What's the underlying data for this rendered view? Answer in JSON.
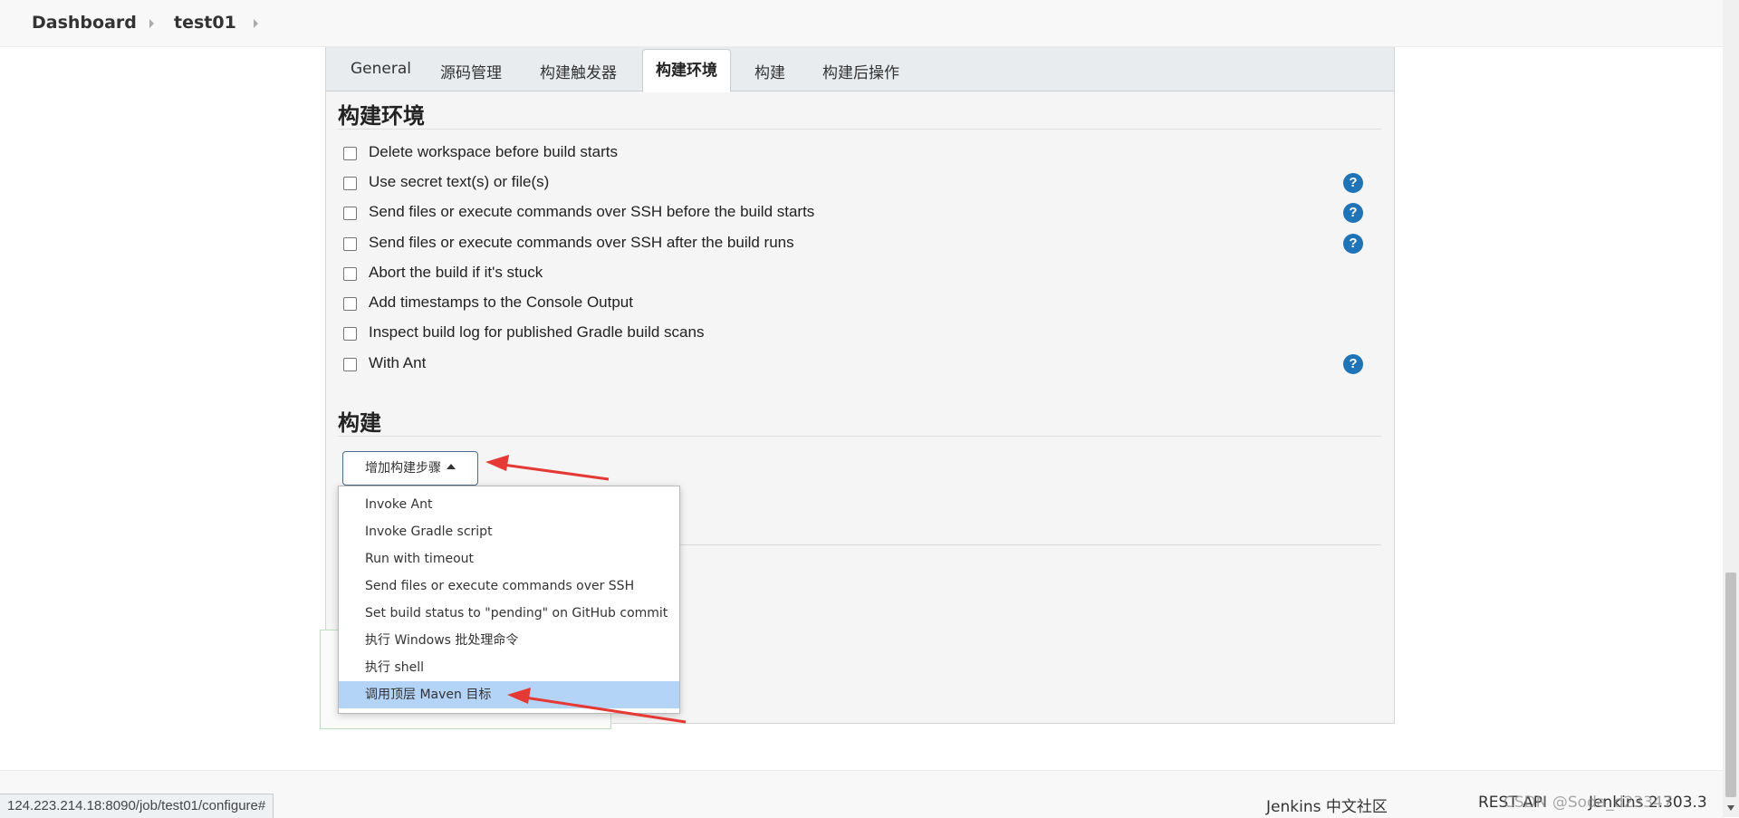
{
  "breadcrumb": {
    "items": [
      "Dashboard",
      "test01"
    ]
  },
  "tabs": [
    "General",
    "源码管理",
    "构建触发器",
    "构建环境",
    "构建",
    "构建后操作"
  ],
  "active_tab": "构建环境",
  "build_env": {
    "title": "构建环境",
    "options": [
      {
        "label": "Delete workspace before build starts",
        "checked": false,
        "help": false
      },
      {
        "label": "Use secret text(s) or file(s)",
        "checked": false,
        "help": true
      },
      {
        "label": "Send files or execute commands over SSH before the build starts",
        "checked": false,
        "help": true
      },
      {
        "label": "Send files or execute commands over SSH after the build runs",
        "checked": false,
        "help": true
      },
      {
        "label": "Abort the build if it's stuck",
        "checked": false,
        "help": false
      },
      {
        "label": "Add timestamps to the Console Output",
        "checked": false,
        "help": false
      },
      {
        "label": "Inspect build log for published Gradle build scans",
        "checked": false,
        "help": false
      },
      {
        "label": "With Ant",
        "checked": false,
        "help": true
      }
    ]
  },
  "build": {
    "title": "构建",
    "add_step_label": "增加构建步骤",
    "menu": [
      "Invoke Ant",
      "Invoke Gradle script",
      "Run with timeout",
      "Send files or execute commands over SSH",
      "Set build status to \"pending\" on GitHub commit",
      "执行 Windows 批处理命令",
      "执行 shell",
      "调用顶层 Maven 目标"
    ],
    "highlighted_item": "调用顶层 Maven 目标"
  },
  "help_glyph": "?",
  "footer": {
    "community": "Jenkins 中文社区",
    "rest_api": "REST API",
    "version": "Jenkins 2.303.3"
  },
  "status_url": "124.223.214.18:8090/job/test01/configure#",
  "watermark": "CSDN @Soda_d23347",
  "colors": {
    "help": "#1f73b7",
    "highlight": "#b3d3f7",
    "arrow": "#e53935"
  }
}
